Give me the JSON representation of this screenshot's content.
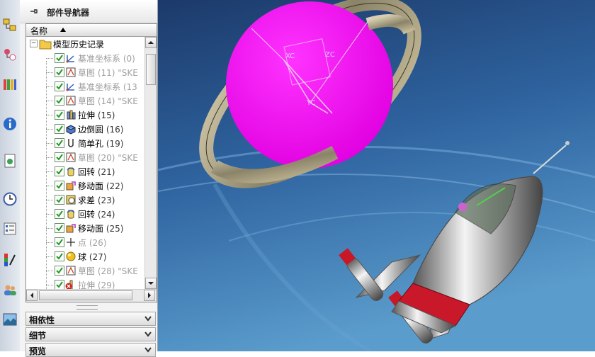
{
  "navigator": {
    "title": "部件导航器",
    "column_header": "名称",
    "root_label": "模型历史记录",
    "items": [
      {
        "name": "基准坐标系",
        "num": "(0)",
        "grey": true,
        "icon": "datum-csys-icon"
      },
      {
        "name": "草图",
        "num": "(11) \"SKE",
        "grey": true,
        "icon": "sketch-icon"
      },
      {
        "name": "基准坐标系",
        "num": "(13",
        "grey": true,
        "icon": "datum-csys-icon"
      },
      {
        "name": "草图",
        "num": "(14) \"SKE",
        "grey": true,
        "icon": "sketch-icon"
      },
      {
        "name": "拉伸",
        "num": "(15)",
        "grey": false,
        "icon": "extrude-icon"
      },
      {
        "name": "边倒圆",
        "num": "(16)",
        "grey": false,
        "icon": "edge-blend-icon"
      },
      {
        "name": "简单孔",
        "num": "(19)",
        "grey": false,
        "icon": "simple-hole-icon"
      },
      {
        "name": "草图",
        "num": "(20) \"SKE",
        "grey": true,
        "icon": "sketch-icon"
      },
      {
        "name": "回转",
        "num": "(21)",
        "grey": false,
        "icon": "revolve-icon"
      },
      {
        "name": "移动面",
        "num": "(22)",
        "grey": false,
        "icon": "move-face-icon"
      },
      {
        "name": "求差",
        "num": "(23)",
        "grey": false,
        "icon": "subtract-icon"
      },
      {
        "name": "回转",
        "num": "(24)",
        "grey": false,
        "icon": "revolve-icon"
      },
      {
        "name": "移动面",
        "num": "(25)",
        "grey": false,
        "icon": "move-face-icon"
      },
      {
        "name": "点",
        "num": "(26)",
        "grey": true,
        "icon": "point-icon"
      },
      {
        "name": "球",
        "num": "(27)",
        "grey": false,
        "icon": "sphere-icon"
      },
      {
        "name": "草图",
        "num": "(28) \"SKE",
        "grey": true,
        "icon": "sketch-icon"
      },
      {
        "name": "拉伸",
        "num": "(29)",
        "grey": true,
        "icon": "extrude-error-icon"
      }
    ],
    "sections": [
      "相依性",
      "细节",
      "预览"
    ]
  },
  "viewport": {
    "csys_labels": [
      "XC",
      "ZC",
      "YC"
    ]
  },
  "colors": {
    "accent": "#ff00ff",
    "check": "#1f9a1f",
    "background_top": "#1c3a6a",
    "background_bottom": "#4a8cc0"
  }
}
